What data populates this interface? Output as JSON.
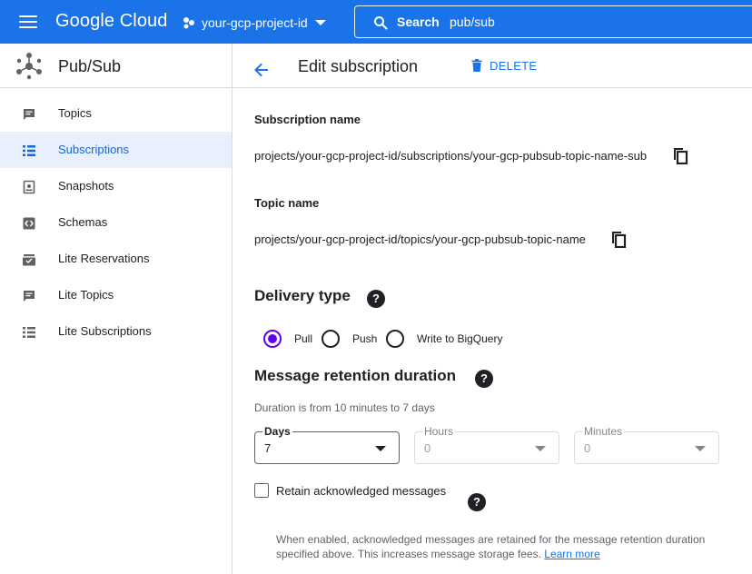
{
  "topbar": {
    "brand": "Google Cloud",
    "project": "your-gcp-project-id",
    "search_label": "Search",
    "search_value": "pub/sub"
  },
  "sidebar": {
    "title": "Pub/Sub",
    "items": [
      {
        "label": "Topics",
        "icon": "topics-icon"
      },
      {
        "label": "Subscriptions",
        "icon": "subscriptions-icon",
        "active": true
      },
      {
        "label": "Snapshots",
        "icon": "snapshots-icon"
      },
      {
        "label": "Schemas",
        "icon": "schemas-icon"
      },
      {
        "label": "Lite Reservations",
        "icon": "lite-reservations-icon"
      },
      {
        "label": "Lite Topics",
        "icon": "lite-topics-icon"
      },
      {
        "label": "Lite Subscriptions",
        "icon": "lite-subscriptions-icon"
      }
    ]
  },
  "header": {
    "title": "Edit subscription",
    "delete_label": "DELETE"
  },
  "subscription": {
    "name_label": "Subscription name",
    "name_value": "projects/your-gcp-project-id/subscriptions/your-gcp-pubsub-topic-name-sub",
    "topic_label": "Topic name",
    "topic_value": "projects/your-gcp-project-id/topics/your-gcp-pubsub-topic-name"
  },
  "delivery": {
    "title": "Delivery type",
    "help": "?",
    "options": [
      {
        "label": "Pull",
        "checked": true
      },
      {
        "label": "Push",
        "checked": false
      },
      {
        "label": "Write to BigQuery",
        "checked": false
      }
    ]
  },
  "retention": {
    "title": "Message retention duration",
    "help": "?",
    "hint": "Duration is from 10 minutes to 7 days",
    "days": {
      "label": "Days",
      "value": "7"
    },
    "hours": {
      "label": "Hours",
      "value": "0"
    },
    "minutes": {
      "label": "Minutes",
      "value": "0"
    },
    "retain_label": "Retain acknowledged messages",
    "retain_checked": false,
    "retain_help": "?",
    "desc": "When enabled, acknowledged messages are retained for the message retention duration specified above. This increases message storage fees.",
    "learn_more": "Learn more"
  },
  "colors": {
    "brand_blue": "#1a73e8",
    "radio_purple": "#6200ee",
    "active_nav_bg": "#e8f0fe"
  }
}
